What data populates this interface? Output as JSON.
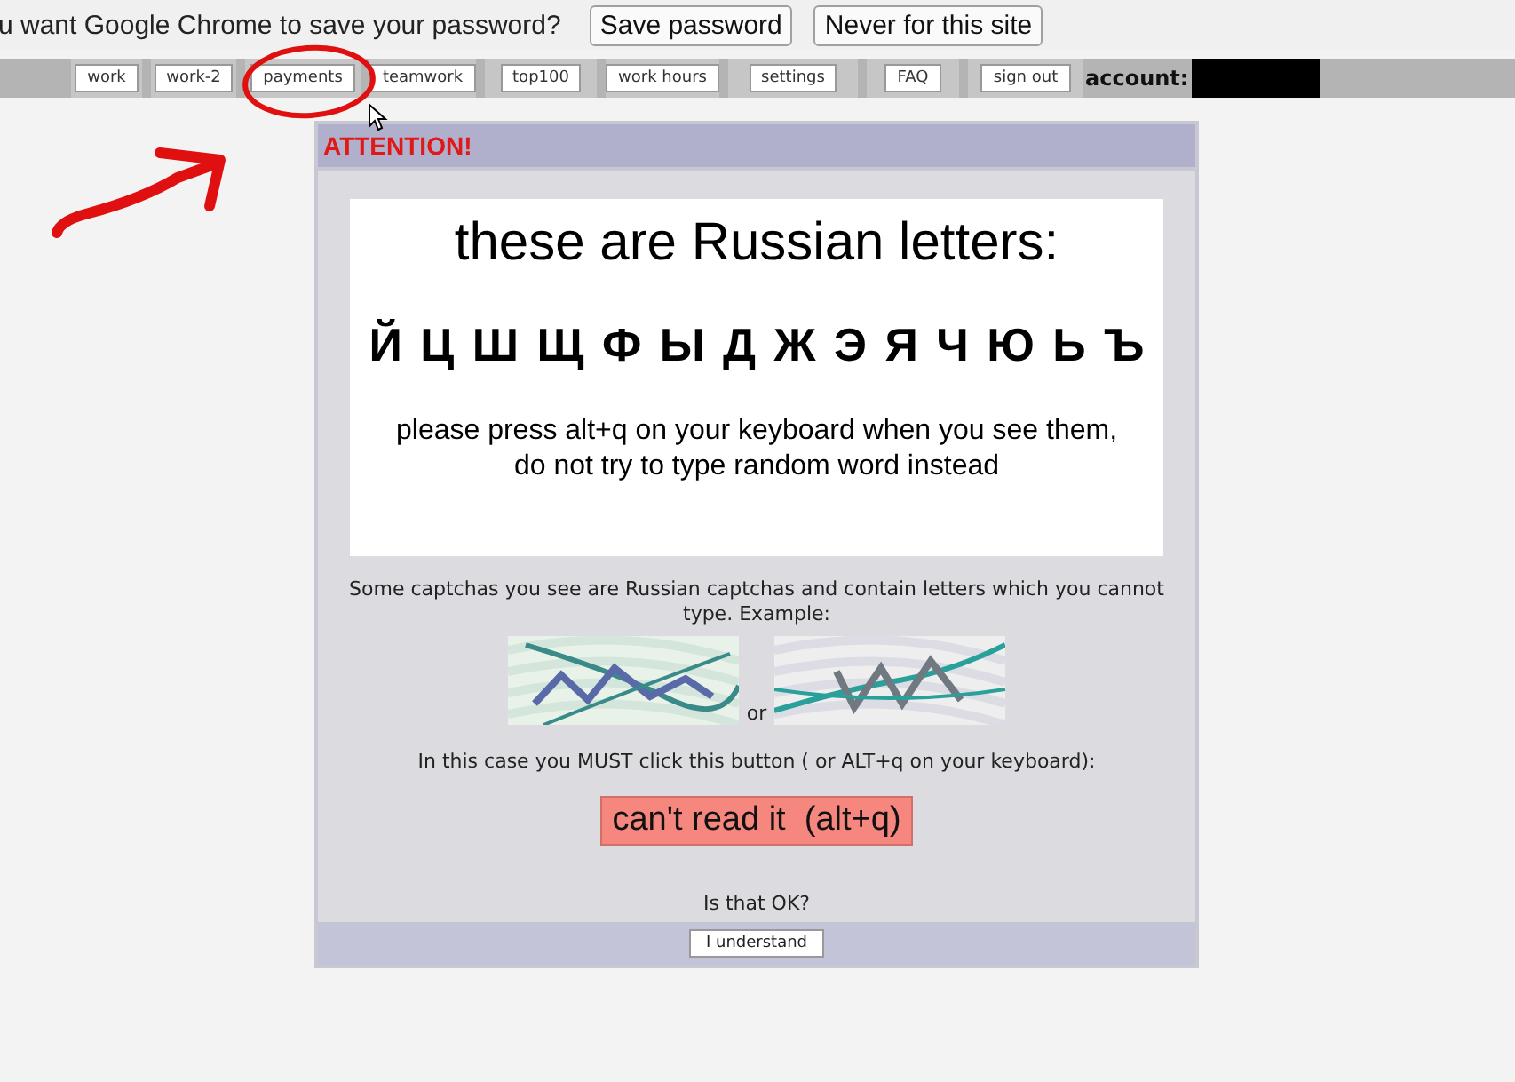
{
  "infobar": {
    "message": "u want Google Chrome to save your password?",
    "buttons": [
      "Save password",
      "Never for this site"
    ]
  },
  "nav": {
    "items": [
      "work",
      "work-2",
      "payments",
      "teamwork",
      "top100",
      "work hours",
      "settings",
      "FAQ",
      "sign out"
    ],
    "account_label": "account:"
  },
  "panel": {
    "title": "ATTENTION!",
    "headline": "these are Russian letters:",
    "letters": "Й Ц Ш Щ Ф Ы Д Ж Э Я Ч Ю Ь Ъ",
    "instruction_lines": [
      "please press alt+q on your keyboard when you see them,",
      "do not try to type random word instead"
    ],
    "note": "Some captchas you see are Russian captchas and contain letters which you cannot type. Example:",
    "separator": "or",
    "must_text": "In this case you MUST click this button ( or ALT+q on your keyboard):",
    "cant_read_button": "can't read it  (alt+q)",
    "question": "Is that OK?",
    "confirm_button": "I understand"
  }
}
